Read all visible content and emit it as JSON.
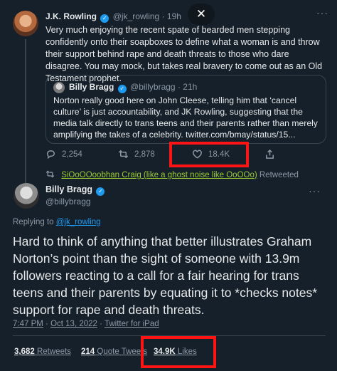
{
  "colors": {
    "background": "#15202b",
    "text": "#e7e9ea",
    "muted": "#8b98a5",
    "link": "#1d9bf0",
    "highlight_box": "#ff1414",
    "retweet_link": "#9ccc33"
  },
  "parent_tweet": {
    "author_name": "J.K. Rowling",
    "author_handle": "@jk_rowling",
    "time": "19h",
    "text": "Very much enjoying the recent spate of bearded men stepping confidently onto their soapboxes to define what a woman is and throw their support behind rape and death threats to those who dare disagree. You may mock, but takes real bravery to come out as an Old Testament prophet.",
    "quoted": {
      "author_name": "Billy Bragg",
      "author_handle": "@billybragg",
      "time": "21h",
      "text": "Norton really good here on John Cleese, telling him that ‘cancel culture’ is just accountability, and JK Rowling, suggesting that the media talk directly to trans teens and their parents rather than merely amplifying the takes of a celebrity. twitter.com/bmay/status/15..."
    },
    "actions": {
      "replies": "2,254",
      "retweets": "2,878",
      "likes": "18.4K"
    }
  },
  "overlay": {
    "close_icon": "close-icon",
    "close_glyph": "✕"
  },
  "retweet_context": {
    "name": "SiOoOOoobhan Craig (like a ghost noise like OoOOo)",
    "suffix": " Retweeted"
  },
  "main_tweet": {
    "author_name": "Billy Bragg",
    "author_handle": "@billybragg",
    "replying_prefix": "Replying to ",
    "replying_handle": "@jk_rowling",
    "text": "Hard to think of anything that better illustrates Graham Norton’s point than the sight of someone with 13.9m followers reacting to a call for a fair hearing for trans teens and their parents by equating it to *checks notes* support for rape and death threats.",
    "time": "7:47 PM",
    "date": "Oct 13, 2022",
    "client": "Twitter for iPad",
    "stats": {
      "retweets_count": "3,682",
      "retweets_label": " Retweets",
      "quotes_count": "214",
      "quotes_label": " Quote Tweets",
      "likes_count": "34.9K",
      "likes_label": " Likes"
    }
  },
  "more_glyph": "···"
}
